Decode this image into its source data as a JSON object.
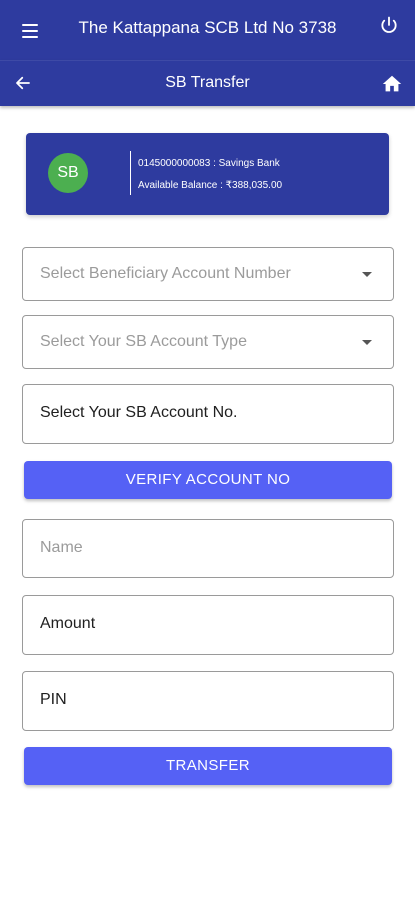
{
  "app": {
    "title": "The Kattappana SCB Ltd No 3738",
    "menu_icon": "menu-icon",
    "power_icon": "power-icon"
  },
  "subheader": {
    "title": "SB Transfer",
    "back_icon": "back-arrow-icon",
    "home_icon": "home-icon"
  },
  "account_card": {
    "avatar_text": "SB",
    "account_line": "0145000000083 : Savings Bank",
    "balance_line": "Available Balance : ₹388,035.00",
    "colors": {
      "card": "#2e3b9f",
      "avatar": "#4caf50"
    }
  },
  "form": {
    "beneficiary_placeholder": "Select Beneficiary Account Number",
    "sb_account_type_placeholder": "Select Your SB Account Type",
    "sb_account_no_value": "Select Your SB Account No.",
    "verify_button": "VERIFY ACCOUNT NO",
    "name_placeholder": "Name",
    "amount_value": "Amount",
    "pin_value": "PIN",
    "transfer_button": "TRANSFER"
  },
  "colors": {
    "primary": "#2e3b9f",
    "button": "#5561f5"
  }
}
